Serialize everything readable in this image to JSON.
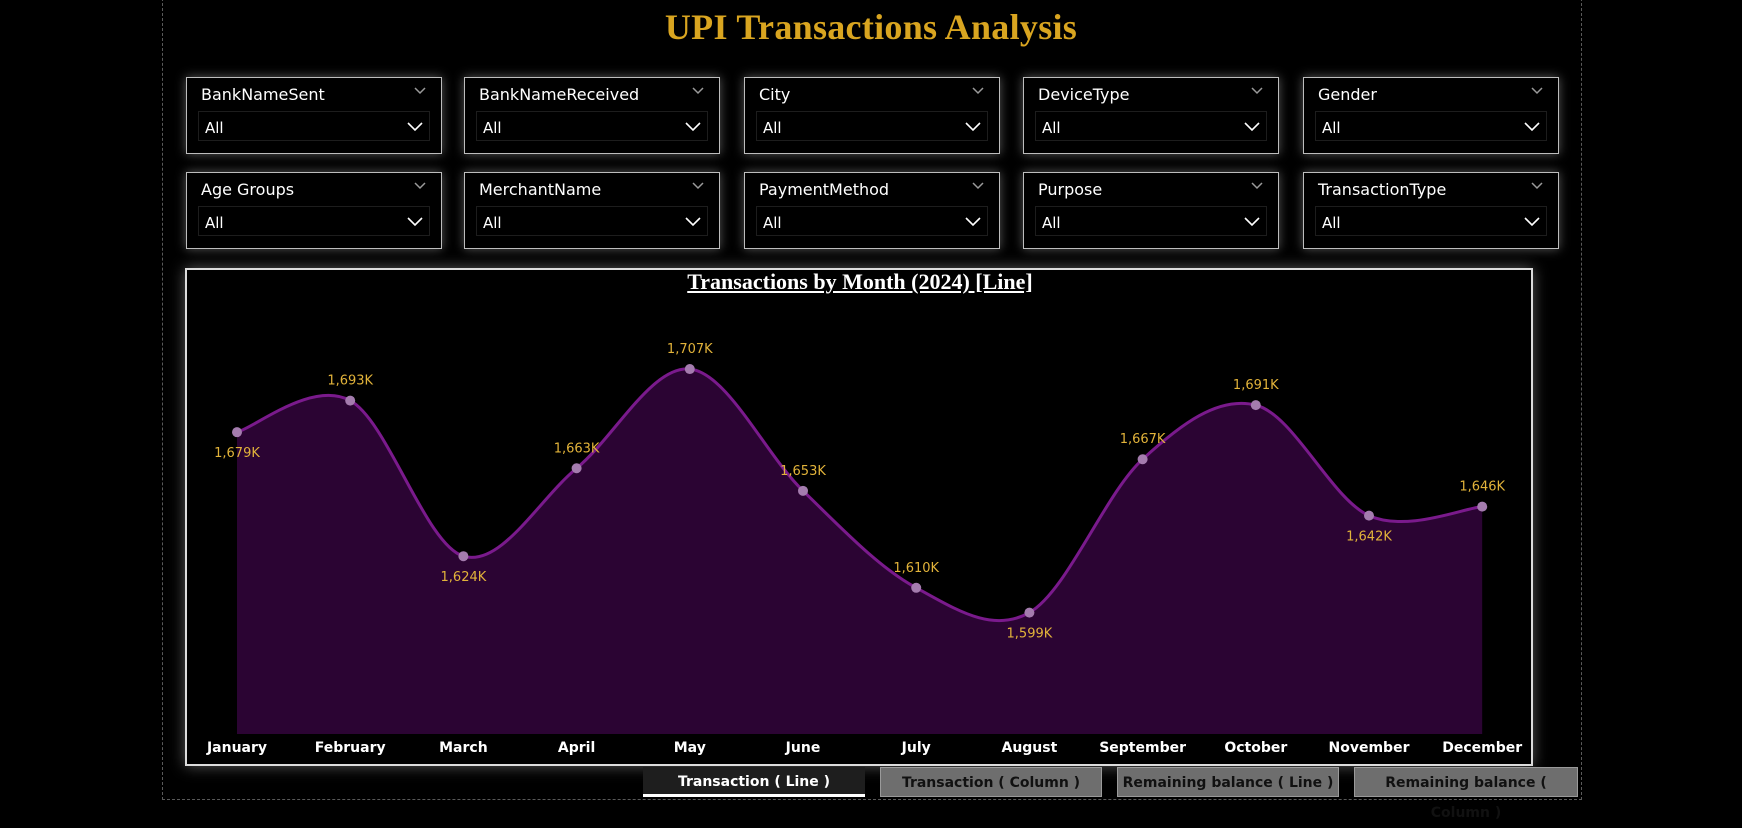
{
  "page": {
    "title": "UPI Transactions Analysis"
  },
  "slicers": [
    {
      "label": "BankNameSent",
      "value": "All"
    },
    {
      "label": "BankNameReceived",
      "value": "All"
    },
    {
      "label": "City",
      "value": "All"
    },
    {
      "label": "DeviceType",
      "value": "All"
    },
    {
      "label": "Gender",
      "value": "All"
    },
    {
      "label": "Age Groups",
      "value": "All"
    },
    {
      "label": "MerchantName",
      "value": "All"
    },
    {
      "label": "PaymentMethod",
      "value": "All"
    },
    {
      "label": "Purpose",
      "value": "All"
    },
    {
      "label": "TransactionType",
      "value": "All"
    }
  ],
  "colors": {
    "title": "#d9a520",
    "line": "#7a1a8c",
    "area": "#2b0433",
    "point": "#a47cae",
    "data_label": "#e2b33a",
    "axis_label": "#ffffff"
  },
  "chart_data": {
    "type": "area",
    "title": "Transactions by Month (2024) [Line]",
    "categories": [
      "January",
      "February",
      "March",
      "April",
      "May",
      "June",
      "July",
      "August",
      "September",
      "October",
      "November",
      "December"
    ],
    "values": [
      1679,
      1693,
      1624,
      1663,
      1707,
      1653,
      1610,
      1599,
      1667,
      1691,
      1642,
      1646
    ],
    "data_labels": [
      "1,679K",
      "1,693K",
      "1,624K",
      "1,663K",
      "1,707K",
      "1,653K",
      "1,610K",
      "1,599K",
      "1,667K",
      "1,691K",
      "1,642K",
      "1,646K"
    ],
    "ylim": [
      1570,
      1715
    ],
    "grid": false,
    "legend": "none"
  },
  "tabs": [
    {
      "label": "Transaction ( Line )",
      "active": true
    },
    {
      "label": "Transaction ( Column )",
      "active": false
    },
    {
      "label": "Remaining balance ( Line )",
      "active": false
    },
    {
      "label": "Remaining balance ( Column )",
      "active": false
    }
  ]
}
